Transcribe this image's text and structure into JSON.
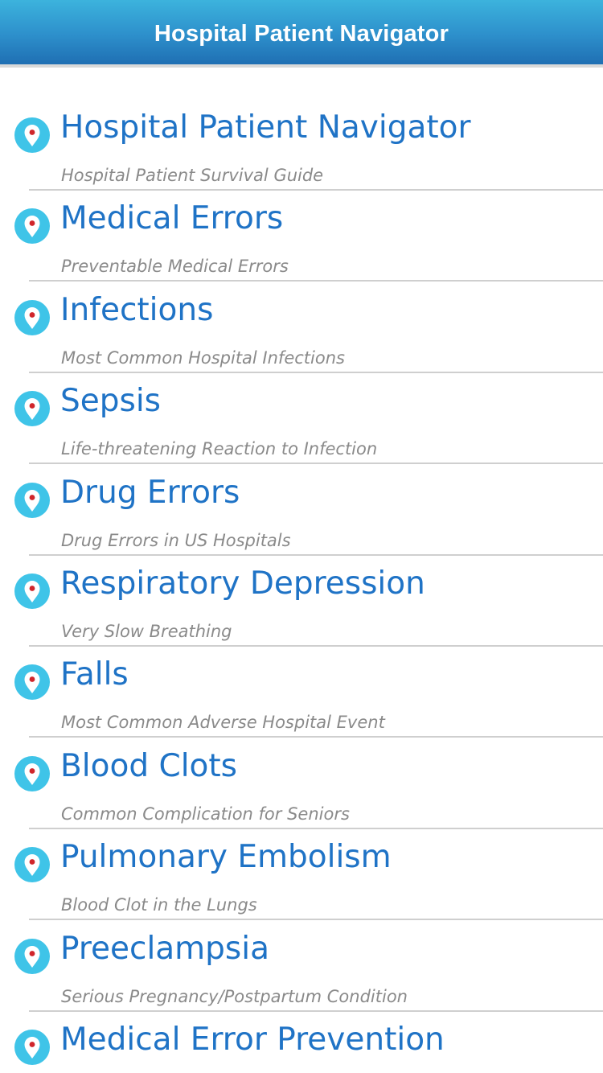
{
  "header": {
    "title": "Hospital Patient Navigator"
  },
  "colors": {
    "accent": "#1f73c6",
    "nav_bar": "#2d8fcb",
    "pin_fill": "#3fc4e8",
    "pin_dot": "#d0262b"
  },
  "list": {
    "items": [
      {
        "title": "Hospital Patient Navigator",
        "subtitle": "Hospital Patient Survival Guide",
        "icon": "location-pin-icon"
      },
      {
        "title": "Medical Errors",
        "subtitle": "Preventable Medical Errors",
        "icon": "location-pin-icon"
      },
      {
        "title": "Infections",
        "subtitle": "Most Common Hospital Infections",
        "icon": "location-pin-icon"
      },
      {
        "title": "Sepsis",
        "subtitle": "Life-threatening Reaction to Infection",
        "icon": "location-pin-icon"
      },
      {
        "title": "Drug Errors",
        "subtitle": "Drug Errors in US Hospitals",
        "icon": "location-pin-icon"
      },
      {
        "title": "Respiratory Depression",
        "subtitle": "Very Slow Breathing",
        "icon": "location-pin-icon"
      },
      {
        "title": "Falls",
        "subtitle": "Most Common Adverse Hospital Event",
        "icon": "location-pin-icon"
      },
      {
        "title": "Blood Clots",
        "subtitle": "Common Complication for Seniors",
        "icon": "location-pin-icon"
      },
      {
        "title": "Pulmonary Embolism",
        "subtitle": "Blood Clot in the Lungs",
        "icon": "location-pin-icon"
      },
      {
        "title": "Preeclampsia",
        "subtitle": "Serious Pregnancy/Postpartum Condition",
        "icon": "location-pin-icon"
      },
      {
        "title": "Medical Error Prevention",
        "subtitle": "",
        "icon": "location-pin-icon"
      }
    ]
  }
}
